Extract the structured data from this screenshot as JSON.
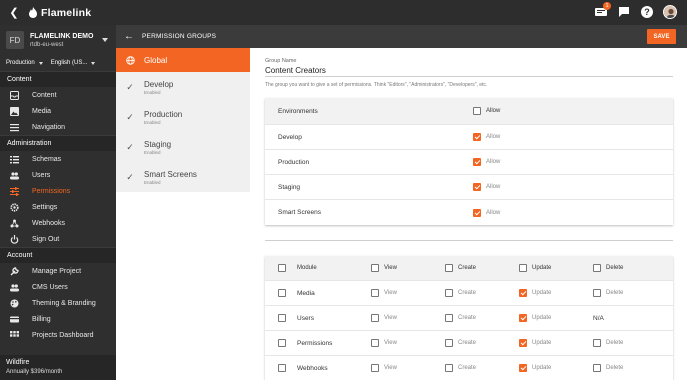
{
  "app": {
    "name": "Flamelink",
    "notification_count": "1"
  },
  "project": {
    "initials": "FD",
    "name": "FLAMELINK DEMO",
    "region": "rtdb-eu-west",
    "environment": "Production",
    "locale": "English (US..."
  },
  "sidebar": {
    "content_heading": "Content",
    "content_items": [
      {
        "label": "Content",
        "icon": "inbox-icon"
      },
      {
        "label": "Media",
        "icon": "image-icon"
      },
      {
        "label": "Navigation",
        "icon": "menu-icon"
      }
    ],
    "admin_heading": "Administration",
    "admin_items": [
      {
        "label": "Schemas",
        "icon": "list-icon"
      },
      {
        "label": "Users",
        "icon": "people-icon"
      },
      {
        "label": "Permissions",
        "icon": "sliders-icon"
      },
      {
        "label": "Settings",
        "icon": "gear-icon"
      },
      {
        "label": "Webhooks",
        "icon": "webhook-icon"
      },
      {
        "label": "Sign Out",
        "icon": "power-icon"
      }
    ],
    "account_heading": "Account",
    "account_items": [
      {
        "label": "Manage Project",
        "icon": "wrench-icon"
      },
      {
        "label": "CMS Users",
        "icon": "people-icon"
      },
      {
        "label": "Theming & Branding",
        "icon": "palette-icon"
      },
      {
        "label": "Billing",
        "icon": "card-icon"
      },
      {
        "label": "Projects Dashboard",
        "icon": "grid-icon"
      }
    ],
    "plan_name": "Wildfire",
    "plan_price": "Annually $396/month",
    "active_color": "#f26522"
  },
  "subheader": {
    "title": "PERMISSION GROUPS",
    "save_label": "SAVE"
  },
  "groups": [
    {
      "name": "Global",
      "status": ""
    },
    {
      "name": "Develop",
      "status": "Enabled"
    },
    {
      "name": "Production",
      "status": "Enabled"
    },
    {
      "name": "Staging",
      "status": "Enabled"
    },
    {
      "name": "Smart Screens",
      "status": "Enabled"
    }
  ],
  "form": {
    "group_name_label": "Group Name",
    "group_name_value": "Content Creators",
    "group_name_help": "The group you want to give a set of permissions. Think \"Editors\", \"Administrators\", \"Developers\", etc."
  },
  "environments": {
    "header": "Environments",
    "allow_header": "Allow",
    "allow_label": "Allow",
    "rows": [
      {
        "name": "Develop",
        "allow": true
      },
      {
        "name": "Production",
        "allow": true
      },
      {
        "name": "Staging",
        "allow": true
      },
      {
        "name": "Smart Screens",
        "allow": true
      }
    ]
  },
  "modules": {
    "headers": {
      "module": "Module",
      "view": "View",
      "create": "Create",
      "update": "Update",
      "delete": "Delete"
    },
    "labels": {
      "view": "View",
      "create": "Create",
      "update": "Update",
      "delete": "Delete"
    },
    "rows": [
      {
        "name": "Media",
        "view": false,
        "create": false,
        "update": true,
        "delete": "off"
      },
      {
        "name": "Users",
        "view": false,
        "create": false,
        "update": true,
        "delete": "N/A"
      },
      {
        "name": "Permissions",
        "view": false,
        "create": false,
        "update": true,
        "delete": "off"
      },
      {
        "name": "Webhooks",
        "view": false,
        "create": false,
        "update": true,
        "delete": "off"
      }
    ]
  },
  "colors": {
    "accent": "#f26522",
    "topbar": "#2d2d2d",
    "sidebar": "#2f2f2f"
  }
}
